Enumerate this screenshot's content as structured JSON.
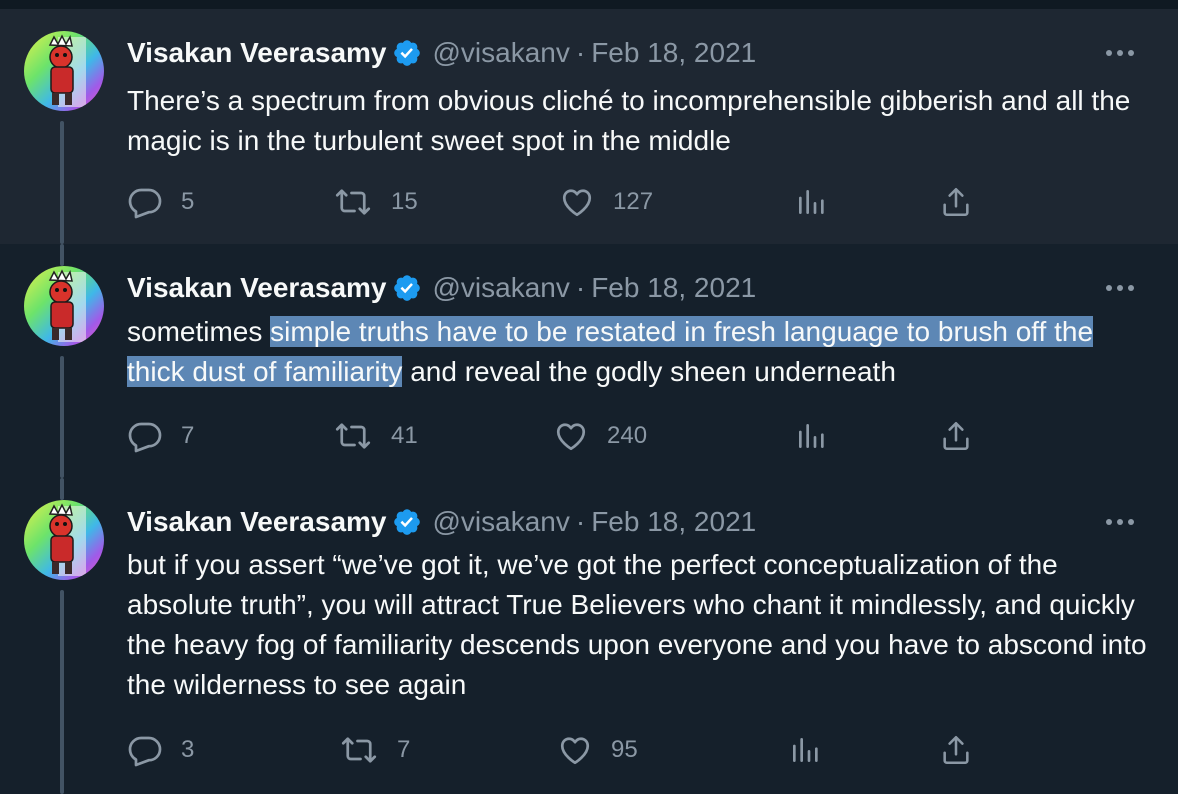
{
  "tweets": [
    {
      "author_name": "Visakan Veerasamy",
      "handle": "@visakanv",
      "separator": "·",
      "date": "Feb 18, 2021",
      "text": "There’s a spectrum from obvious cliché to incomprehensible gibberish and all the magic is in the turbulent sweet spot in the middle",
      "replies": "5",
      "retweets": "15",
      "likes": "127"
    },
    {
      "author_name": "Visakan Veerasamy",
      "handle": "@visakanv",
      "separator": "·",
      "date": "Feb 18, 2021",
      "text_before": "sometimes ",
      "text_highlighted": "simple truths have to be restated in fresh language to brush off the thick dust of familiarity",
      "text_after": " and reveal the godly sheen underneath",
      "replies": "7",
      "retweets": "41",
      "likes": "240"
    },
    {
      "author_name": "Visakan Veerasamy",
      "handle": "@visakanv",
      "separator": "·",
      "date": "Feb 18, 2021",
      "text": "but if you assert “we’ve got it, we’ve got the perfect conceptualization of the absolute truth”, you will attract True Believers who chant it mindlessly, and quickly the heavy fog of familiarity descends upon everyone and you have to abscond into the wilderness to see again",
      "replies": "3",
      "retweets": "7",
      "likes": "95"
    }
  ],
  "icons": {
    "more": "more-horizontal-icon",
    "verified": "verified-badge-icon",
    "reply": "reply-icon",
    "retweet": "retweet-icon",
    "like": "heart-icon",
    "views": "analytics-icon",
    "share": "share-icon"
  },
  "colors": {
    "background": "#15202b",
    "hovered_background": "#1e2732",
    "text": "#f7f9f9",
    "muted": "#8b98a5",
    "verified": "#1d9bf0",
    "selection": "#5d87b5",
    "thread_line": "#425364"
  }
}
